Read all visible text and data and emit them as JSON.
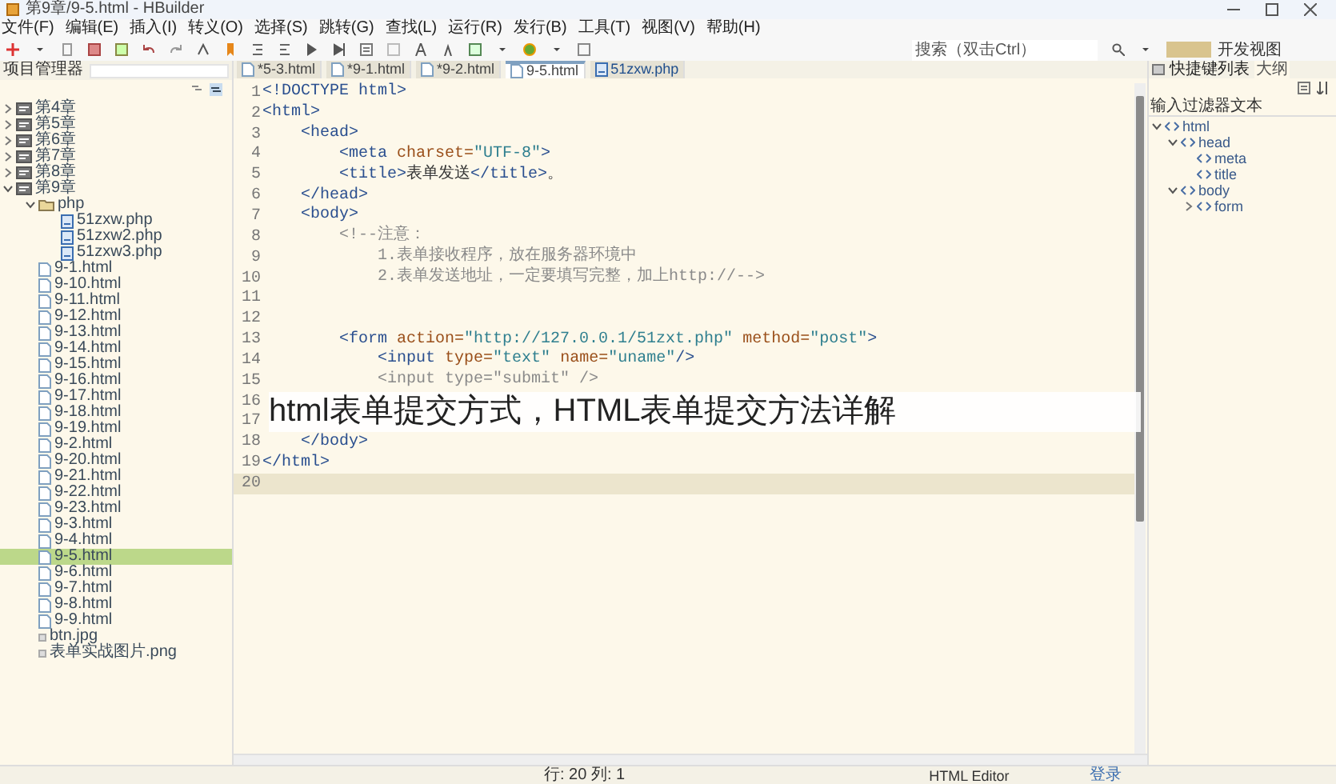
{
  "window": {
    "title": "第9章/9-5.html - HBuilder"
  },
  "menu": [
    "文件(F)",
    "编辑(E)",
    "插入(I)",
    "转义(O)",
    "选择(S)",
    "跳转(G)",
    "查找(L)",
    "运行(R)",
    "发行(B)",
    "工具(T)",
    "视图(V)",
    "帮助(H)"
  ],
  "toolbar": {
    "search": {
      "placeholder": "搜索（双击Ctrl）"
    },
    "perspective": "开发视图"
  },
  "project_panel": {
    "title": "项目管理器",
    "tree": [
      {
        "label": "第4章",
        "kind": "project",
        "expanded": false
      },
      {
        "label": "第5章",
        "kind": "project",
        "expanded": false
      },
      {
        "label": "第6章",
        "kind": "project",
        "expanded": false
      },
      {
        "label": "第7章",
        "kind": "project",
        "expanded": false
      },
      {
        "label": "第8章",
        "kind": "project",
        "expanded": false
      },
      {
        "label": "第9章",
        "kind": "project",
        "expanded": true,
        "children": [
          {
            "label": "php",
            "kind": "folder",
            "expanded": true,
            "children": [
              {
                "label": "51zxw.php",
                "kind": "php",
                "selected": false
              },
              {
                "label": "51zxw2.php",
                "kind": "php",
                "selected": false
              },
              {
                "label": "51zxw3.php",
                "kind": "php",
                "selected": false
              }
            ]
          },
          {
            "label": "9-1.html",
            "kind": "html",
            "selected": false
          },
          {
            "label": "9-10.html",
            "kind": "html",
            "selected": false
          },
          {
            "label": "9-11.html",
            "kind": "html",
            "selected": false
          },
          {
            "label": "9-12.html",
            "kind": "html",
            "selected": false
          },
          {
            "label": "9-13.html",
            "kind": "html",
            "selected": false
          },
          {
            "label": "9-14.html",
            "kind": "html",
            "selected": false
          },
          {
            "label": "9-15.html",
            "kind": "html",
            "selected": false
          },
          {
            "label": "9-16.html",
            "kind": "html",
            "selected": false
          },
          {
            "label": "9-17.html",
            "kind": "html",
            "selected": false
          },
          {
            "label": "9-18.html",
            "kind": "html",
            "selected": false
          },
          {
            "label": "9-19.html",
            "kind": "html",
            "selected": false
          },
          {
            "label": "9-2.html",
            "kind": "html",
            "selected": false
          },
          {
            "label": "9-20.html",
            "kind": "html",
            "selected": false
          },
          {
            "label": "9-21.html",
            "kind": "html",
            "selected": false
          },
          {
            "label": "9-22.html",
            "kind": "html",
            "selected": false
          },
          {
            "label": "9-23.html",
            "kind": "html",
            "selected": false
          },
          {
            "label": "9-3.html",
            "kind": "html",
            "selected": false
          },
          {
            "label": "9-4.html",
            "kind": "html",
            "selected": false
          },
          {
            "label": "9-5.html",
            "kind": "html",
            "selected": true
          },
          {
            "label": "9-6.html",
            "kind": "html",
            "selected": false
          },
          {
            "label": "9-7.html",
            "kind": "html",
            "selected": false
          },
          {
            "label": "9-8.html",
            "kind": "html",
            "selected": false
          },
          {
            "label": "9-9.html",
            "kind": "html",
            "selected": false
          },
          {
            "label": "btn.jpg",
            "kind": "image",
            "selected": false
          },
          {
            "label": "表单实战图片.png",
            "kind": "image",
            "selected": false
          }
        ]
      }
    ]
  },
  "tabs": [
    {
      "label": "*5-3.html",
      "kind": "html",
      "selected": false
    },
    {
      "label": "*9-1.html",
      "kind": "html",
      "selected": false
    },
    {
      "label": "*9-2.html",
      "kind": "html",
      "selected": false
    },
    {
      "label": "9-5.html",
      "kind": "html",
      "selected": true
    },
    {
      "label": "51zxw.php",
      "kind": "php",
      "selected": false
    }
  ],
  "editor": {
    "lines": [
      {
        "number": "1",
        "current": false,
        "tokens": [
          {
            "t": "<!DOCTYPE html>",
            "kind": "tag"
          }
        ]
      },
      {
        "number": "2",
        "current": false,
        "tokens": [
          {
            "t": "<html>",
            "kind": "tag"
          }
        ]
      },
      {
        "number": "3",
        "current": false,
        "tokens": [
          {
            "t": "    <head>",
            "kind": "tag"
          }
        ]
      },
      {
        "number": "4",
        "current": false,
        "tokens": [
          {
            "t": "        <meta ",
            "kind": "tag"
          },
          {
            "t": "charset=",
            "kind": "attr"
          },
          {
            "t": "\"UTF-8\"",
            "kind": "value"
          },
          {
            "t": ">",
            "kind": "tag"
          }
        ]
      },
      {
        "number": "5",
        "current": false,
        "tokens": [
          {
            "t": "        <title>",
            "kind": "tag"
          },
          {
            "t": "表单发送",
            "kind": "text"
          },
          {
            "t": "</title>",
            "kind": "tag"
          },
          {
            "t": "。",
            "kind": "text"
          }
        ]
      },
      {
        "number": "6",
        "current": false,
        "tokens": [
          {
            "t": "    </head>",
            "kind": "tag"
          }
        ]
      },
      {
        "number": "7",
        "current": false,
        "tokens": [
          {
            "t": "    <body>",
            "kind": "tag"
          }
        ]
      },
      {
        "number": "8",
        "current": false,
        "tokens": [
          {
            "t": "        <!--注意：",
            "kind": "comment"
          }
        ]
      },
      {
        "number": "9",
        "current": false,
        "tokens": [
          {
            "t": "            1.表单接收程序，放在服务器环境中",
            "kind": "comment"
          }
        ]
      },
      {
        "number": "10",
        "current": false,
        "tokens": [
          {
            "t": "            2.表单发送地址，一定要填写完整，加上http://-->",
            "kind": "comment"
          }
        ]
      },
      {
        "number": "11",
        "current": false
      },
      {
        "number": "12",
        "current": false
      },
      {
        "number": "13",
        "current": false,
        "tokens": [
          {
            "t": "        <form ",
            "kind": "tag"
          },
          {
            "t": "action=",
            "kind": "attr"
          },
          {
            "t": "\"http://127.0.0.1/51zxt.php\" ",
            "kind": "value"
          },
          {
            "t": "method=",
            "kind": "attr"
          },
          {
            "t": "\"post\"",
            "kind": "value"
          },
          {
            "t": ">",
            "kind": "tag"
          }
        ]
      },
      {
        "number": "14",
        "current": false,
        "tokens": [
          {
            "t": "            <input ",
            "kind": "tag"
          },
          {
            "t": "type=",
            "kind": "attr"
          },
          {
            "t": "\"text\" ",
            "kind": "value"
          },
          {
            "t": "name=",
            "kind": "attr"
          },
          {
            "t": "\"uname\"",
            "kind": "value"
          },
          {
            "t": "/>",
            "kind": "tag"
          }
        ]
      },
      {
        "number": "15",
        "current": false,
        "tokens": [
          {
            "t": "            <input type=\"submit\" />",
            "kind": "comment"
          }
        ]
      },
      {
        "number": "16",
        "current": false
      },
      {
        "number": "17",
        "current": false
      },
      {
        "number": "18",
        "current": false,
        "tokens": [
          {
            "t": "    </body>",
            "kind": "tag"
          }
        ]
      },
      {
        "number": "19",
        "current": false,
        "tokens": [
          {
            "t": "</html>",
            "kind": "tag"
          }
        ]
      },
      {
        "number": "20",
        "current": true
      }
    ]
  },
  "banner": "html表单提交方式，HTML表单提交方法详解",
  "outline_panel": {
    "tabs": [
      {
        "label": "快捷键列表",
        "selected": false
      },
      {
        "label": "大纲",
        "selected": true
      }
    ],
    "filter": {
      "placeholder": "输入过滤器文本"
    },
    "tree": [
      {
        "label": "html",
        "expanded": true,
        "children": [
          {
            "label": "head",
            "expanded": true,
            "children": [
              {
                "label": "meta"
              },
              {
                "label": "title"
              }
            ]
          },
          {
            "label": "body",
            "expanded": true,
            "children": [
              {
                "label": "form",
                "expanded": false
              }
            ]
          }
        ]
      }
    ]
  },
  "status_bar": {
    "position": "行: 20 列: 1",
    "editor_type": "HTML Editor",
    "login": "登录"
  }
}
